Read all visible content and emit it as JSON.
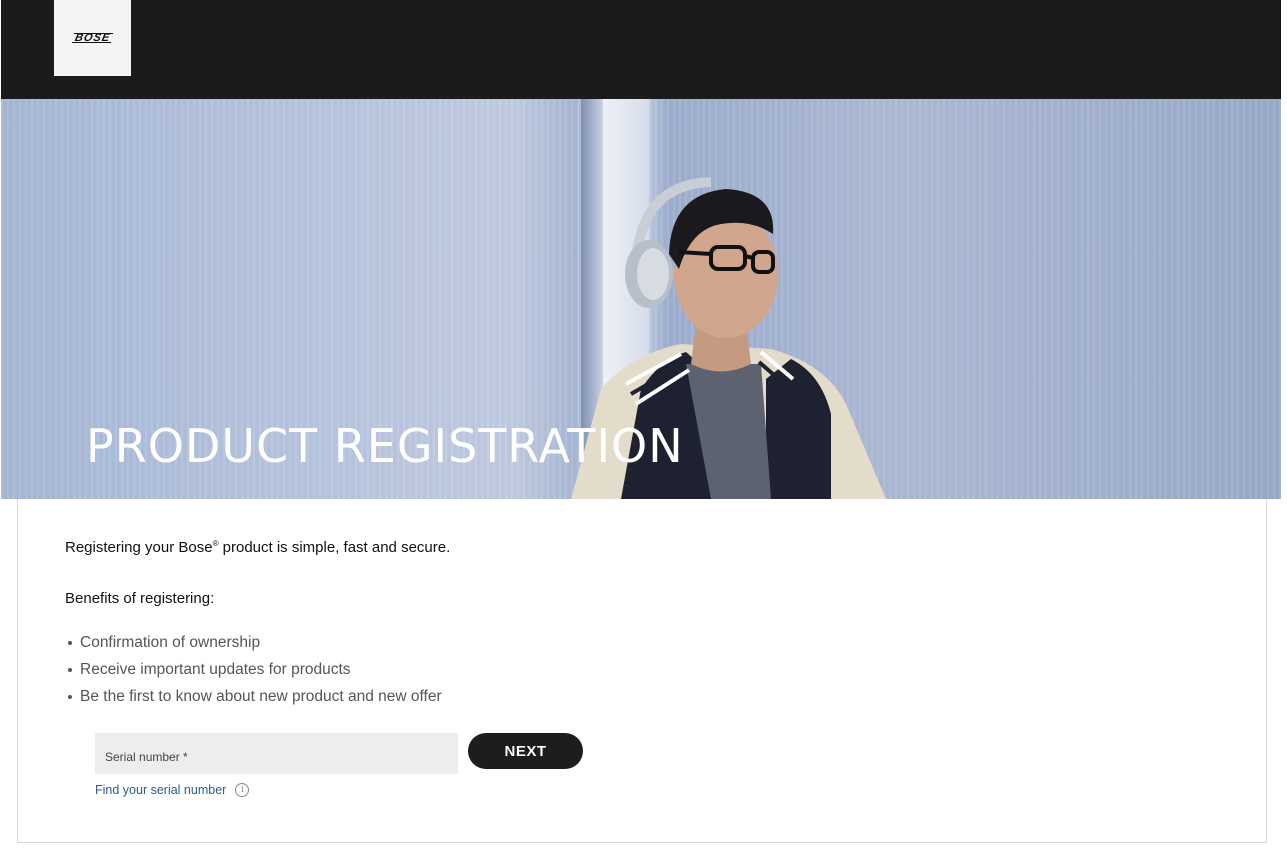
{
  "header": {
    "logo_text": "BOSE"
  },
  "hero": {
    "title": "PRODUCT REGISTRATION"
  },
  "main": {
    "intro_before": "Registering your Bose",
    "intro_mark": "®",
    "intro_after": " product is simple, fast and secure.",
    "benefits_title": "Benefits of registering:",
    "benefits": [
      "Confirmation of ownership",
      "Receive important updates for products",
      "Be the first to know about new product and new offer"
    ]
  },
  "form": {
    "serial_placeholder": "Serial number *",
    "next_label": "NEXT",
    "find_link": "Find your serial number",
    "info_icon": "i"
  },
  "colors": {
    "topbar": "#1b1b1b",
    "button": "#1d1d1d",
    "link": "#2a5c8a"
  }
}
